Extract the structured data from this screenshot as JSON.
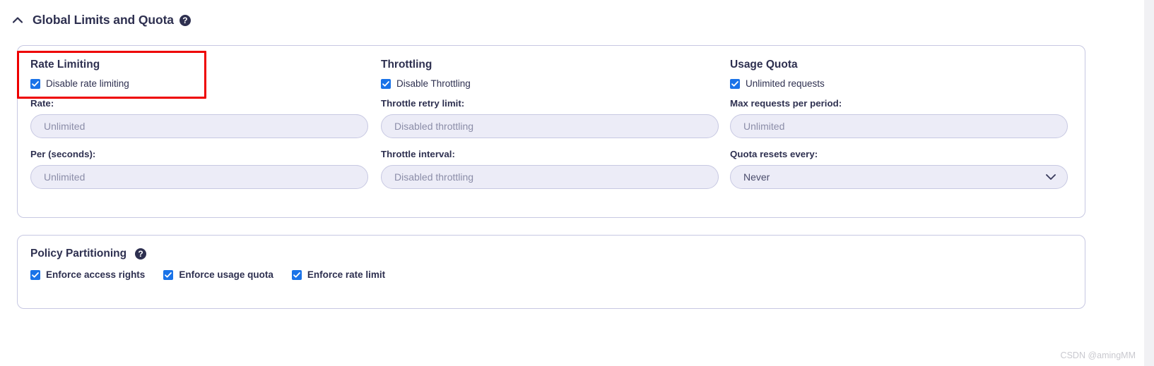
{
  "section": {
    "title": "Global Limits and Quota",
    "help_icon": "help-circle-icon",
    "help_glyph": "?",
    "toggle_icon": "chevron-up-icon",
    "expanded": true
  },
  "limits_card": {
    "columns": [
      {
        "title": "Rate Limiting",
        "checkbox": {
          "label": "Disable rate limiting",
          "checked": true
        },
        "fields": [
          {
            "label": "Rate:",
            "value": "",
            "placeholder": "Unlimited",
            "type": "text"
          },
          {
            "label": "Per (seconds):",
            "value": "",
            "placeholder": "Unlimited",
            "type": "text"
          }
        ]
      },
      {
        "title": "Throttling",
        "checkbox": {
          "label": "Disable Throttling",
          "checked": true
        },
        "fields": [
          {
            "label": "Throttle retry limit:",
            "value": "",
            "placeholder": "Disabled throttling",
            "type": "text"
          },
          {
            "label": "Throttle interval:",
            "value": "",
            "placeholder": "Disabled throttling",
            "type": "text"
          }
        ]
      },
      {
        "title": "Usage Quota",
        "checkbox": {
          "label": "Unlimited requests",
          "checked": true
        },
        "fields": [
          {
            "label": "Max requests per period:",
            "value": "",
            "placeholder": "Unlimited",
            "type": "text"
          },
          {
            "label": "Quota resets every:",
            "value": "Never",
            "placeholder": "",
            "type": "select",
            "chevron_icon": "chevron-down-icon"
          }
        ]
      }
    ]
  },
  "policy_partitioning": {
    "title": "Policy Partitioning",
    "help_glyph": "?",
    "help_icon": "help-circle-icon",
    "checkboxes": [
      {
        "label": "Enforce access rights",
        "checked": true
      },
      {
        "label": "Enforce usage quota",
        "checked": true
      },
      {
        "label": "Enforce rate limit",
        "checked": true
      }
    ]
  },
  "annotation": {
    "highlight_color": "#ee0000",
    "target": "Rate Limiting"
  },
  "watermark": {
    "text": "CSDN @amingMM"
  },
  "colors": {
    "accent_checkbox": "#1a73e8",
    "card_border": "#c7c8e2",
    "input_fill": "#ececf7",
    "text_primary": "#2e3050",
    "text_placeholder": "#8b8da8",
    "annotation_red": "#ee0000"
  }
}
